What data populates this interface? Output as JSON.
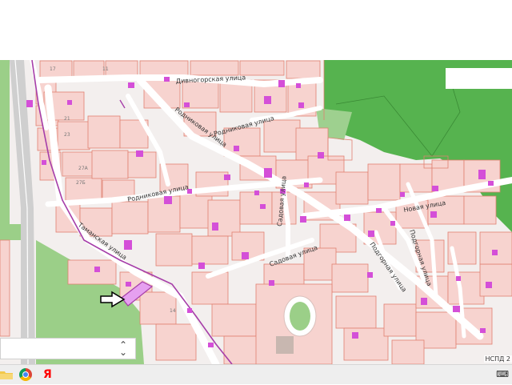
{
  "map": {
    "street_labels": [
      "Дивногорская улица",
      "Родниковая улица",
      "Родниковая улица",
      "Родниковая улица",
      "Таманская улица",
      "Садовая улица",
      "Садовая улица",
      "Новая улица",
      "Подгорная улица",
      "Подгорная улица"
    ],
    "parcel_numbers": [
      "11",
      "17",
      "21",
      "23",
      "27А",
      "27Б",
      "14"
    ],
    "attribution": "НСПД 2",
    "colors": {
      "parcel_fill": "#f7d3cf",
      "parcel_border": "#e08070",
      "building": "#d44fd8",
      "forest": "#56b34f",
      "grass": "#b4d9a0",
      "road": "#ffffff",
      "boundary": "#a63ea9"
    },
    "marker_icon": "arrow-right-outline-icon"
  },
  "search": {
    "chevron_icon": "chevron-updown-icon"
  },
  "taskbar": {
    "icons": [
      "folder-icon",
      "chrome-icon",
      "yandex-icon"
    ],
    "yandex_glyph": "Я",
    "tray_icon": "keyboard-icon"
  }
}
